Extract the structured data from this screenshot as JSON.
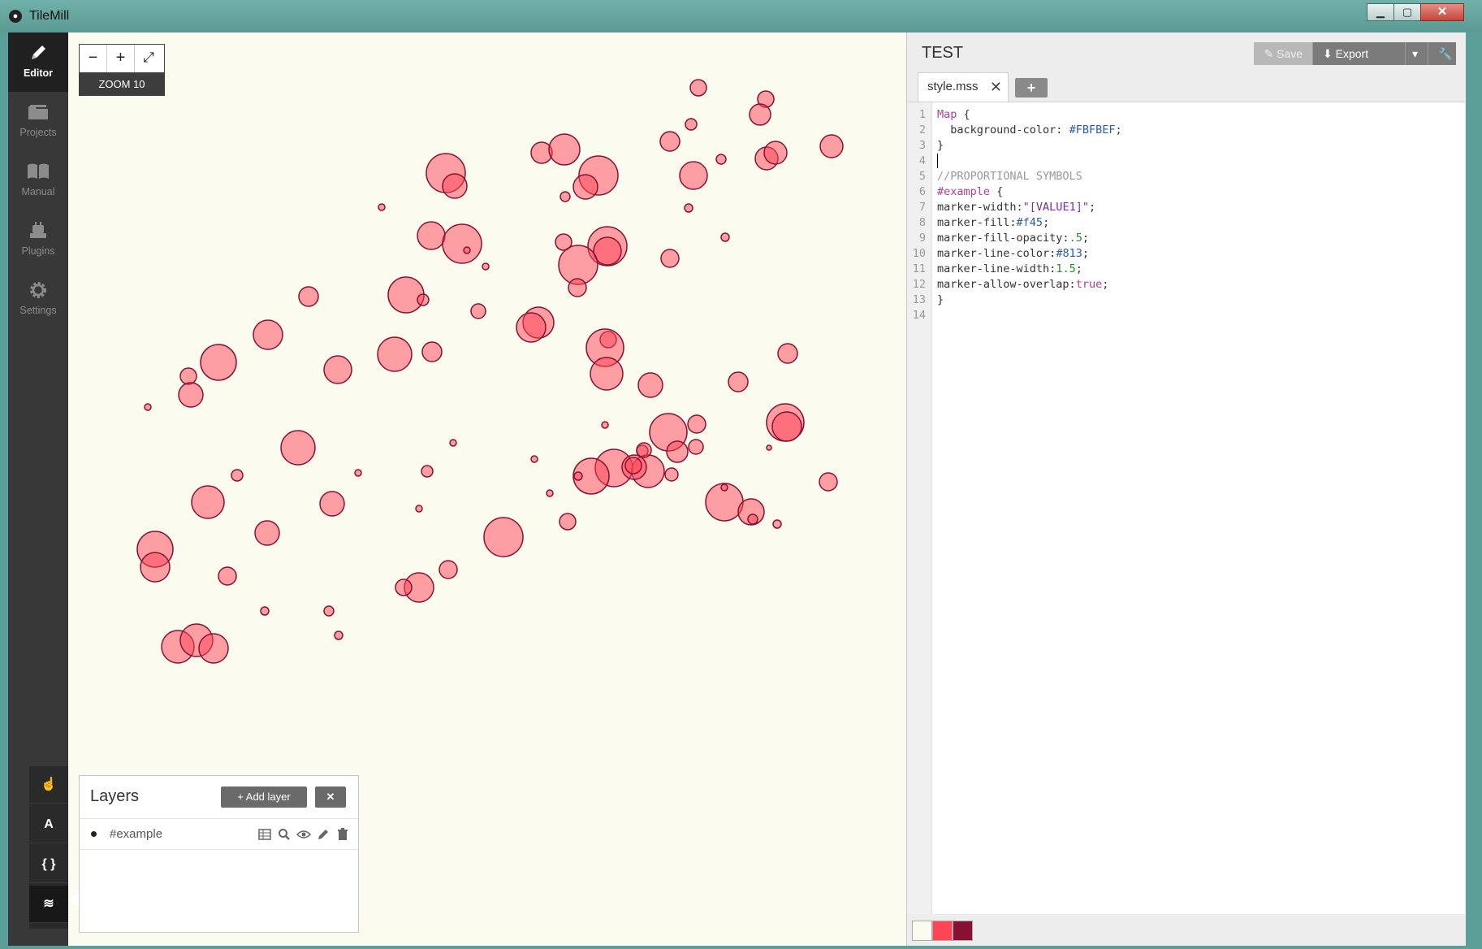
{
  "window": {
    "title": "TileMill",
    "controls": [
      "minimize",
      "maximize",
      "close"
    ]
  },
  "sidebar": {
    "items": [
      {
        "label": "Editor",
        "icon": "pencil-icon",
        "active": true
      },
      {
        "label": "Projects",
        "icon": "folder-icon",
        "active": false
      },
      {
        "label": "Manual",
        "icon": "book-icon",
        "active": false
      },
      {
        "label": "Plugins",
        "icon": "plug-icon",
        "active": false
      },
      {
        "label": "Settings",
        "icon": "gear-icon",
        "active": false
      }
    ],
    "tools": [
      {
        "name": "pan-tool",
        "glyph": "☝",
        "active": false
      },
      {
        "name": "fonts-tool",
        "glyph": "A",
        "active": false
      },
      {
        "name": "carto-tool",
        "glyph": "{ }",
        "active": false
      },
      {
        "name": "layers-tool",
        "glyph": "≋",
        "active": true
      }
    ]
  },
  "map": {
    "background": "#FBFBEF",
    "zoom_label": "ZOOM 10",
    "zoom_buttons": {
      "out": "−",
      "in": "+",
      "fullscreen": "⤢"
    },
    "marker_fill": "#ff4455",
    "marker_fill_opacity": 0.5,
    "marker_line": "#881133",
    "markers": [
      [
        860,
        108,
        10
      ],
      [
        943,
        122,
        10
      ],
      [
        936,
        141,
        13
      ],
      [
        851,
        153,
        7
      ],
      [
        667,
        188,
        13
      ],
      [
        695,
        184,
        19
      ],
      [
        825,
        174,
        12
      ],
      [
        1024,
        180,
        14
      ],
      [
        944,
        195,
        14
      ],
      [
        955,
        188,
        14
      ],
      [
        549,
        213,
        24
      ],
      [
        560,
        229,
        15
      ],
      [
        737,
        216,
        24
      ],
      [
        721,
        230,
        15
      ],
      [
        854,
        216,
        17
      ],
      [
        888,
        196,
        6
      ],
      [
        696,
        242,
        6
      ],
      [
        470,
        255,
        4
      ],
      [
        848,
        256,
        5
      ],
      [
        893,
        292,
        5
      ],
      [
        531,
        290,
        17
      ],
      [
        569,
        300,
        24
      ],
      [
        575,
        308,
        4
      ],
      [
        598,
        328,
        4
      ],
      [
        694,
        298,
        10
      ],
      [
        748,
        303,
        24
      ],
      [
        748,
        309,
        17
      ],
      [
        712,
        326,
        24
      ],
      [
        711,
        354,
        11
      ],
      [
        825,
        318,
        11
      ],
      [
        380,
        365,
        12
      ],
      [
        500,
        363,
        22
      ],
      [
        521,
        369,
        7
      ],
      [
        589,
        383,
        9
      ],
      [
        663,
        397,
        19
      ],
      [
        654,
        403,
        18
      ],
      [
        749,
        418,
        10
      ],
      [
        745,
        428,
        23
      ],
      [
        747,
        460,
        20
      ],
      [
        330,
        412,
        18
      ],
      [
        269,
        446,
        22
      ],
      [
        232,
        463,
        10
      ],
      [
        235,
        486,
        15
      ],
      [
        416,
        455,
        17
      ],
      [
        486,
        436,
        21
      ],
      [
        532,
        433,
        12
      ],
      [
        801,
        474,
        15
      ],
      [
        909,
        470,
        12
      ],
      [
        970,
        435,
        12
      ],
      [
        182,
        501,
        4
      ],
      [
        858,
        522,
        11
      ],
      [
        967,
        520,
        23
      ],
      [
        969,
        525,
        18
      ],
      [
        745,
        523,
        4
      ],
      [
        857,
        550,
        9
      ],
      [
        367,
        551,
        21
      ],
      [
        823,
        532,
        23
      ],
      [
        834,
        556,
        13
      ],
      [
        791,
        555,
        7
      ],
      [
        756,
        576,
        23
      ],
      [
        798,
        580,
        20
      ],
      [
        728,
        586,
        22
      ],
      [
        781,
        575,
        15
      ],
      [
        780,
        573,
        10
      ],
      [
        793,
        554,
        9
      ],
      [
        558,
        545,
        4
      ],
      [
        441,
        582,
        4
      ],
      [
        526,
        580,
        7
      ],
      [
        658,
        565,
        4
      ],
      [
        712,
        586,
        5
      ],
      [
        827,
        584,
        8
      ],
      [
        947,
        551,
        3
      ],
      [
        1020,
        593,
        11
      ],
      [
        292,
        585,
        7
      ],
      [
        256,
        618,
        20
      ],
      [
        409,
        620,
        15
      ],
      [
        677,
        607,
        4
      ],
      [
        516,
        626,
        4
      ],
      [
        620,
        661,
        24
      ],
      [
        699,
        642,
        10
      ],
      [
        892,
        618,
        23
      ],
      [
        925,
        630,
        16
      ],
      [
        927,
        639,
        6
      ],
      [
        892,
        600,
        4
      ],
      [
        957,
        645,
        5
      ],
      [
        329,
        656,
        15
      ],
      [
        191,
        676,
        22
      ],
      [
        191,
        698,
        18
      ],
      [
        280,
        709,
        11
      ],
      [
        552,
        701,
        11
      ],
      [
        516,
        723,
        18
      ],
      [
        497,
        723,
        10
      ],
      [
        326,
        752,
        5
      ],
      [
        405,
        752,
        6
      ],
      [
        417,
        782,
        5
      ],
      [
        219,
        796,
        20
      ],
      [
        242,
        788,
        20
      ],
      [
        263,
        798,
        18
      ]
    ]
  },
  "layers": {
    "title": "Layers",
    "add_label": "Add layer",
    "close_glyph": "✕",
    "items": [
      {
        "name": "#example"
      }
    ]
  },
  "editor": {
    "project_title": "TEST",
    "toolbar": {
      "save_label": "Save",
      "export_label": "Export"
    },
    "tab": {
      "label": "style.mss",
      "close_glyph": "✕",
      "add_glyph": "+"
    },
    "code": [
      "Map {",
      "  background-color: #FBFBEF;",
      "}",
      "",
      "//PROPORTIONAL SYMBOLS",
      "#example {",
      "marker-width:\"[VALUE1]\";",
      "marker-fill:#f45;",
      "marker-fill-opacity:.5;",
      "marker-line-color:#813;",
      "marker-line-width:1.5;",
      "marker-allow-overlap:true;",
      "}",
      ""
    ],
    "palette": [
      "#FBFBEF",
      "#ff4455",
      "#881133"
    ]
  }
}
